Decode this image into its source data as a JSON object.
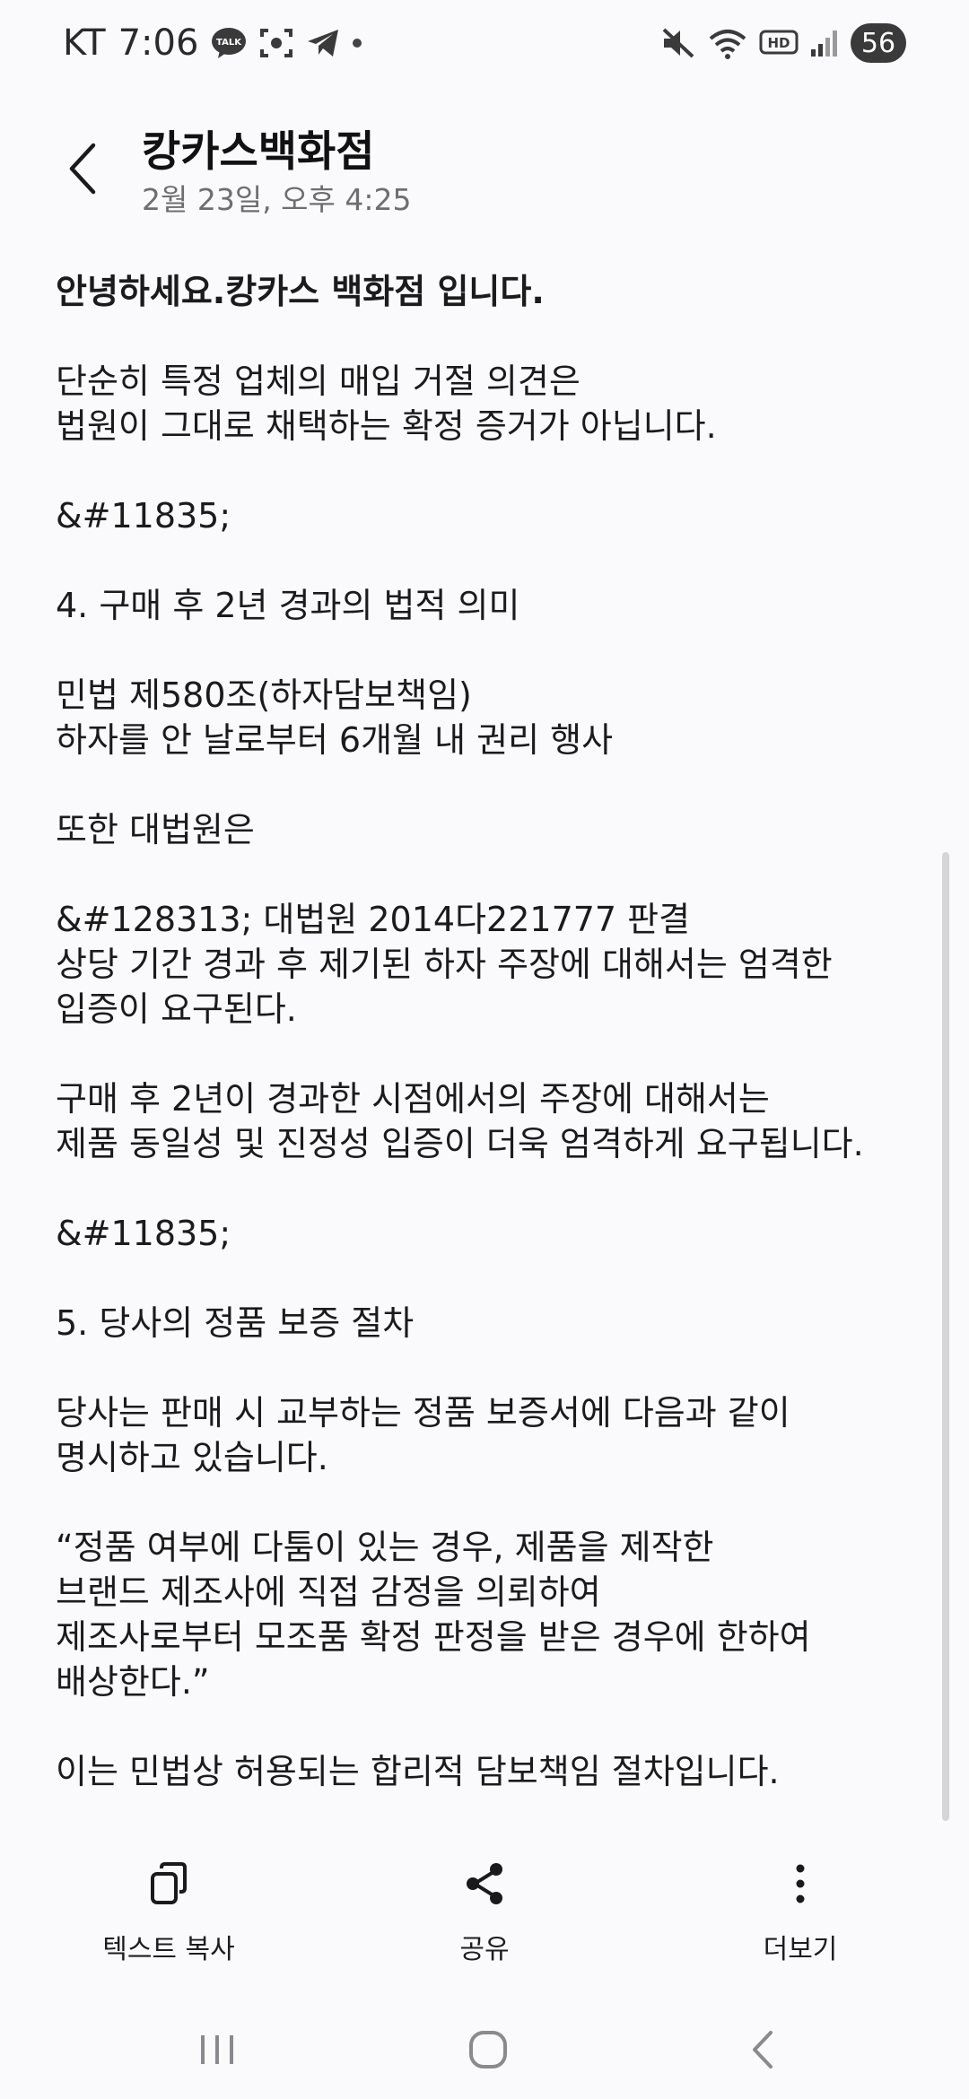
{
  "status_bar": {
    "carrier": "KT",
    "time": "7:06",
    "talk_badge": "TALK",
    "hd_badge": "HD",
    "battery_level": "56"
  },
  "header": {
    "title": "캉카스백화점",
    "date": "2월 23일, 오후 4:25"
  },
  "message": {
    "paragraphs": [
      "안녕하세요.캉카스 백화점 입니다.",
      "단순히 특정 업체의 매입 거절 의견은\n법원이 그대로 채택하는 확정 증거가 아닙니다.",
      "&#11835;",
      "4. 구매 후 2년 경과의 법적 의미",
      "민법 제580조(하자담보책임)\n하자를 안 날로부터 6개월 내 권리 행사",
      "또한 대법원은",
      "&#128313; 대법원 2014다221777 판결\n상당 기간 경과 후 제기된 하자 주장에 대해서는 엄격한\n입증이 요구된다.",
      "구매 후 2년이 경과한 시점에서의 주장에 대해서는\n제품 동일성 및 진정성 입증이 더욱 엄격하게 요구됩니다.",
      "&#11835;",
      "5. 당사의 정품 보증 절차",
      "당사는 판매 시 교부하는 정품 보증서에 다음과 같이\n명시하고 있습니다.",
      "“정품 여부에 다툼이 있는 경우, 제품을 제작한\n브랜드 제조사에 직접 감정을 의뢰하여\n제조사로부터 모조품 확정 판정을 받은 경우에 한하여\n배상한다.”",
      "이는 민법상 허용되는 합리적 담보책임 절차입니다."
    ]
  },
  "actions": {
    "copy_text": "텍스트 복사",
    "share": "공유",
    "more": "더보기"
  },
  "icons": {
    "back": "chevron-left-icon",
    "copy": "copy-icon",
    "share": "share-icon",
    "more": "more-vertical-icon"
  }
}
